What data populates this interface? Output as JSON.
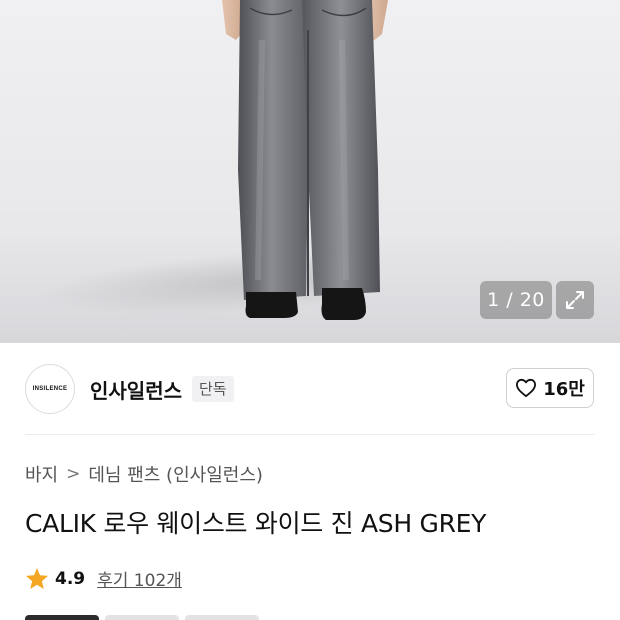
{
  "gallery": {
    "current": 1,
    "total": 20,
    "counter_text": "1 / 20",
    "expand_icon": "expand-icon"
  },
  "brand": {
    "logo_text": "INSILENCE",
    "name": "인사일런스",
    "badge": "단독",
    "like_count": "16만",
    "like_icon": "heart-outline-icon"
  },
  "breadcrumb": {
    "items": [
      "바지",
      "데님 팬츠 (인사일런스)"
    ],
    "separator": ">"
  },
  "product": {
    "title": "CALIK 로우 웨이스트 와이드 진 ASH GREY"
  },
  "rating": {
    "score": "4.9",
    "reviews": "후기 102개",
    "star_color": "#f5a623"
  },
  "colors": {
    "star": "#f5a623",
    "text": "#111111",
    "muted": "#555555"
  }
}
